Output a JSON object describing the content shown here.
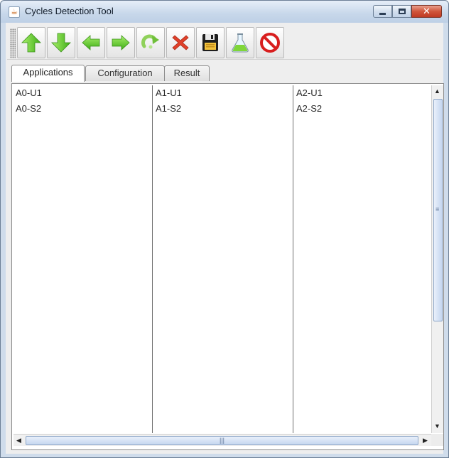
{
  "window": {
    "title": "Cycles Detection Tool",
    "icon": "java-cup-icon"
  },
  "toolbar": {
    "buttons": [
      {
        "name": "move-up-button",
        "icon": "arrow-up-icon"
      },
      {
        "name": "move-down-button",
        "icon": "arrow-down-icon"
      },
      {
        "name": "move-left-button",
        "icon": "arrow-left-icon"
      },
      {
        "name": "move-right-button",
        "icon": "arrow-right-icon"
      },
      {
        "name": "redo-button",
        "icon": "redo-icon"
      },
      {
        "name": "delete-button",
        "icon": "red-x-icon"
      },
      {
        "name": "save-button",
        "icon": "floppy-disk-icon"
      },
      {
        "name": "test-button",
        "icon": "flask-icon"
      },
      {
        "name": "stop-button",
        "icon": "no-entry-icon"
      }
    ]
  },
  "tabs": [
    {
      "label": "Applications",
      "active": true
    },
    {
      "label": "Configuration",
      "active": false
    },
    {
      "label": "Result",
      "active": false
    }
  ],
  "lists": [
    {
      "items": [
        "A0-U1",
        "A0-S2"
      ]
    },
    {
      "items": [
        "A1-U1",
        "A1-S2"
      ]
    },
    {
      "items": [
        "A2-U1",
        "A2-S2"
      ]
    }
  ],
  "colors": {
    "accent_green": "#5fcf2e",
    "delete_red": "#e0402a",
    "scroll_thumb": "#c5d6ef"
  }
}
